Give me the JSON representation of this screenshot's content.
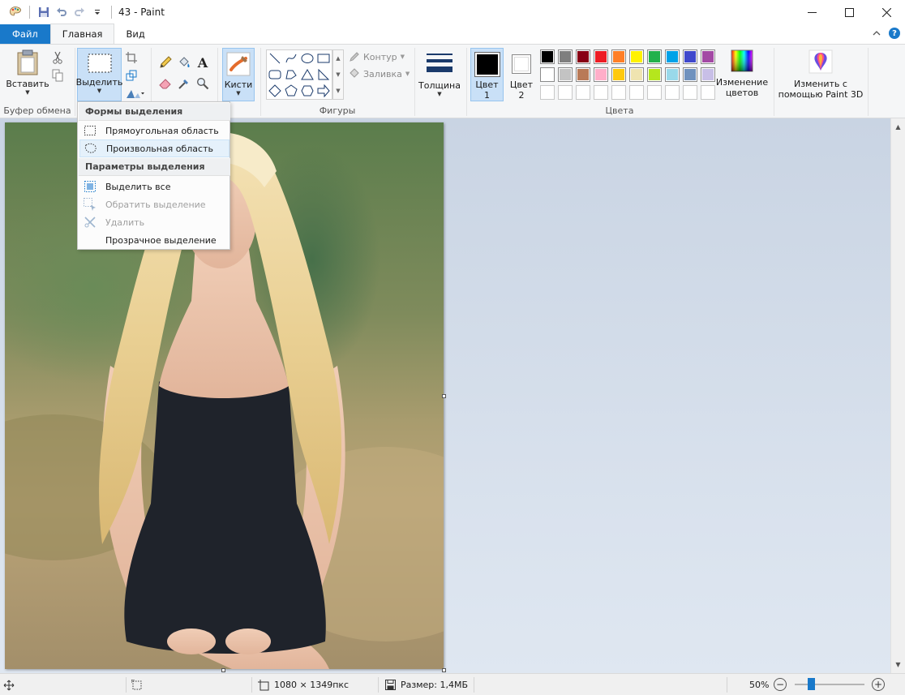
{
  "window": {
    "title": "43 - Paint"
  },
  "tabs": {
    "file": "Файл",
    "home": "Главная",
    "view": "Вид"
  },
  "ribbon": {
    "clipboard": {
      "paste": "Вставить",
      "group": "Буфер обмена"
    },
    "image": {
      "select": "Выделить"
    },
    "tools": {
      "brushes": "Кисти"
    },
    "shapes": {
      "outline": "Контур",
      "fill": "Заливка",
      "group": "Фигуры"
    },
    "size": {
      "label": "Толщина"
    },
    "colors": {
      "color1_line1": "Цвет",
      "color1_line2": "1",
      "color2_line1": "Цвет",
      "color2_line2": "2",
      "edit_line1": "Изменение",
      "edit_line2": "цветов",
      "group": "Цвета",
      "primary": "#000000",
      "secondary": "#ffffff",
      "palette_row1": [
        "#000000",
        "#7f7f7f",
        "#880015",
        "#ed1c24",
        "#ff7f27",
        "#fff200",
        "#22b14c",
        "#00a2e8",
        "#3f48cc",
        "#a349a4"
      ],
      "palette_row2": [
        "#ffffff",
        "#c3c3c3",
        "#b97a57",
        "#ffaec9",
        "#ffc90e",
        "#efe4b0",
        "#b5e61d",
        "#99d9ea",
        "#7092be",
        "#c8bfe7"
      ]
    },
    "paint3d": {
      "line1": "Изменить с",
      "line2": "помощью Paint 3D"
    }
  },
  "select_menu": {
    "header_shapes": "Формы выделения",
    "rect": "Прямоугольная область",
    "free": "Произвольная область",
    "header_options": "Параметры выделения",
    "select_all": "Выделить все",
    "invert": "Обратить выделение",
    "delete": "Удалить",
    "transparent": "Прозрачное выделение"
  },
  "status": {
    "dimensions": "1080 × 1349пкс",
    "size": "Размер: 1,4МБ",
    "zoom": "50%",
    "zoom_fraction": 0.5
  }
}
